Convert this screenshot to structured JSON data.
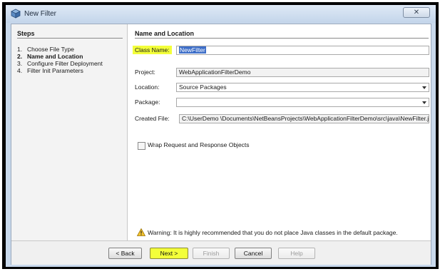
{
  "window": {
    "title": "New Filter",
    "close_glyph": "✕"
  },
  "steps": {
    "title": "Steps",
    "items": [
      {
        "num": "1.",
        "label": "Choose File Type"
      },
      {
        "num": "2.",
        "label": "Name and Location"
      },
      {
        "num": "3.",
        "label": "Configure Filter Deployment"
      },
      {
        "num": "4.",
        "label": "Filter Init Parameters"
      }
    ],
    "active_index": 1
  },
  "panel": {
    "title": "Name and Location",
    "class_name_label": "Class Name:",
    "class_name_value": "NewFilter",
    "project_label": "Project:",
    "project_value": "WebApplicationFilterDemo",
    "location_label": "Location:",
    "location_value": "Source Packages",
    "package_label": "Package:",
    "package_value": "",
    "created_file_label": "Created File:",
    "created_file_value": "C:\\UserDemo \\Documents\\NetBeansProjects\\WebApplicationFilterDemo\\src\\java\\NewFilter.java",
    "wrap_label": "Wrap Request and Response Objects",
    "wrap_checked": false,
    "warning_text": "Warning: It is highly recommended that you do not place Java classes in the default package."
  },
  "buttons": {
    "back": "< Back",
    "next": "Next >",
    "finish": "Finish",
    "cancel": "Cancel",
    "help": "Help"
  },
  "colors": {
    "highlight": "#f3ff3a",
    "selection": "#3d6ec8",
    "title_bar": "#c3d5ea"
  }
}
